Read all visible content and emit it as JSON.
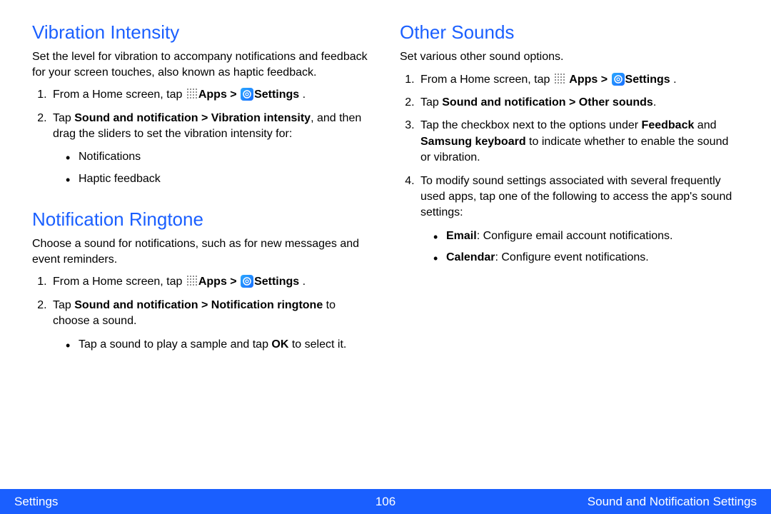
{
  "left": {
    "section1": {
      "heading": "Vibration Intensity",
      "desc": "Set the level for vibration to accompany notifications and feedback for your screen touches, also known as haptic feedback.",
      "step1_pre": "From a Home screen, tap ",
      "step1_apps": "Apps > ",
      "step1_settings": "Settings",
      "step1_end": " .",
      "step2_pre": "Tap ",
      "step2_bold": "Sound and notification > Vibration intensity",
      "step2_post": ", and then drag the sliders to set the vibration intensity for:",
      "bullet1": "Notifications",
      "bullet2": "Haptic feedback"
    },
    "section2": {
      "heading": "Notification Ringtone",
      "desc": "Choose a sound for notifications, such as for new messages and event reminders.",
      "step1_pre": "From a Home screen, tap ",
      "step1_apps": "Apps > ",
      "step1_settings": "Settings",
      "step1_end": " .",
      "step2_pre": "Tap ",
      "step2_bold": "Sound and notification > Notification ringtone",
      "step2_post": " to choose a sound.",
      "bullet1_pre": "Tap a sound to play a sample and tap ",
      "bullet1_bold": "OK",
      "bullet1_post": " to select it."
    }
  },
  "right": {
    "section1": {
      "heading": "Other Sounds",
      "desc": "Set various other sound options.",
      "step1_pre": "From a Home screen, tap ",
      "step1_apps": "Apps > ",
      "step1_settings": "Settings",
      "step1_end": " .",
      "step2_pre": "Tap ",
      "step2_bold": "Sound and notification > Other sounds",
      "step2_post": ".",
      "step3_pre": "Tap the checkbox next to the options under ",
      "step3_b1": "Feedback",
      "step3_mid": " and ",
      "step3_b2": "Samsung keyboard",
      "step3_post": " to indicate whether to enable the sound or vibration.",
      "step4": "To modify sound settings associated with several frequently used apps, tap one of the following to access the app's sound settings:",
      "bullet1_b": "Email",
      "bullet1_rest": ": Configure email account notifications.",
      "bullet2_b": "Calendar",
      "bullet2_rest": ": Configure event notifications."
    }
  },
  "footer": {
    "left": "Settings",
    "center": "106",
    "right": "Sound and Notification Settings"
  }
}
